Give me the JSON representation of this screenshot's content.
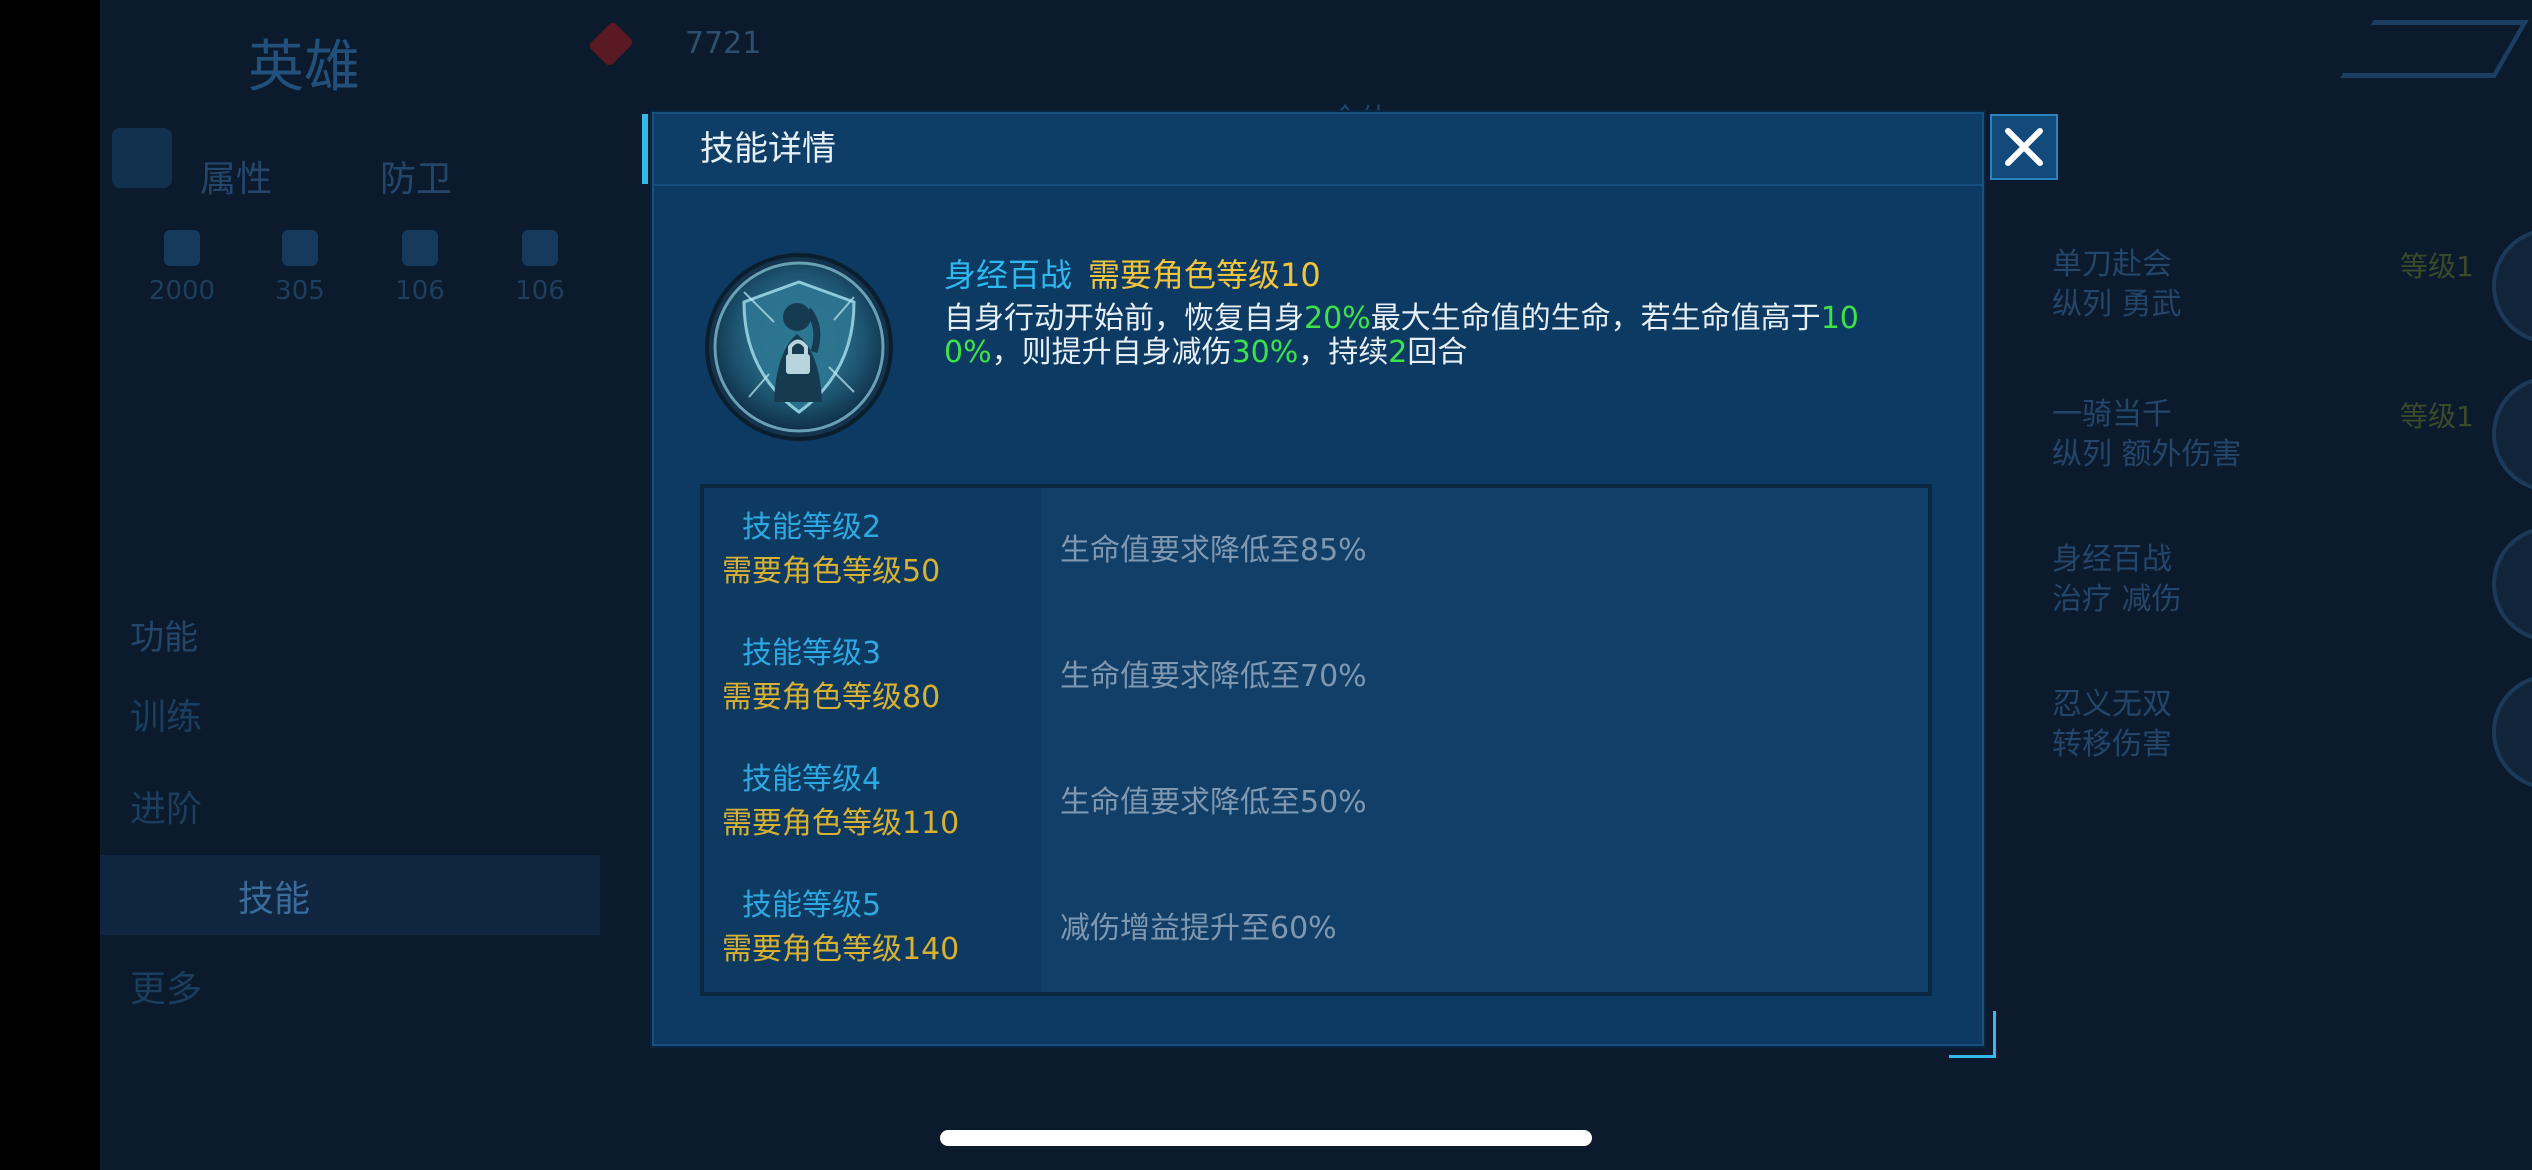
{
  "background": {
    "title": "英雄",
    "currency": "7721",
    "tabs": [
      "属性",
      "防卫"
    ],
    "stats": [
      "2000",
      "305",
      "106",
      "106"
    ],
    "function_header": "功能",
    "menu": [
      "训练",
      "进阶",
      "技能",
      "更多"
    ],
    "center_banner": "全体",
    "skills": [
      {
        "name": "单刀赴会",
        "tags": "纵列 勇武",
        "level": "等级1"
      },
      {
        "name": "一骑当千",
        "tags": "纵列 额外伤害",
        "level": "等级1"
      },
      {
        "name": "身经百战",
        "tags": "治疗 减伤",
        "level": ""
      },
      {
        "name": "忍义无双",
        "tags": "转移伤害",
        "level": ""
      }
    ]
  },
  "dialog": {
    "title": "技能详情",
    "skill_name": "身经百战",
    "skill_requirement": "需要角色等级10",
    "description": {
      "p1": "自身行动开始前，恢复自身",
      "v1": "20%",
      "p2": "最大生命值的生命，若生命值高于",
      "v2": "100%",
      "p3": "，则提升自身减伤",
      "v3": "30%",
      "p4": "，持续",
      "v4": "2",
      "p5": "回合"
    },
    "levels": [
      {
        "name": "技能等级2",
        "requirement": "需要角色等级50",
        "effect": "生命值要求降低至85%"
      },
      {
        "name": "技能等级3",
        "requirement": "需要角色等级80",
        "effect": "生命值要求降低至70%"
      },
      {
        "name": "技能等级4",
        "requirement": "需要角色等级110",
        "effect": "生命值要求降低至50%"
      },
      {
        "name": "技能等级5",
        "requirement": "需要角色等级140",
        "effect": "减伤增益提升至60%"
      }
    ]
  },
  "icons": [
    "close-icon",
    "lock-icon",
    "shield-icon",
    "search-icon",
    "heart-icon",
    "sword-icon"
  ],
  "colors": {
    "accent": "#2eb8f0",
    "highlight": "#3ce24a",
    "requirement": "#f2c43a"
  }
}
